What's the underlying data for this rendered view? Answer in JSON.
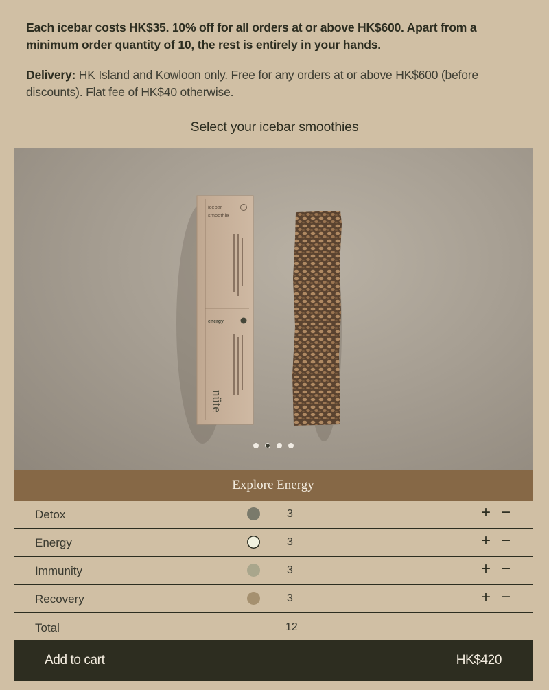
{
  "intro": {
    "pricing_text": "Each icebar costs HK$35. 10% off for all orders at or above HK$600. Apart from a minimum order quantity of 10, the rest is entirely in your hands.",
    "delivery_label": "Delivery:",
    "delivery_text": " HK Island and Kowloon only. Free for any orders at or above HK$600 (before discounts). Flat fee of HK$40 otherwise."
  },
  "section_title": "Select your icebar smoothies",
  "carousel": {
    "box": {
      "brand_line1": "icebar",
      "brand_line2": "smoothie",
      "flavor": "energy",
      "logo": "nüte"
    },
    "slide_count": 4,
    "active_slide": 2
  },
  "explore_label": "Explore Energy",
  "flavors": [
    {
      "name": "Detox",
      "color": "#7a7a6b",
      "qty": "3"
    },
    {
      "name": "Energy",
      "color": "#f1f1df",
      "qty": "3"
    },
    {
      "name": "Immunity",
      "color": "#a9a68c",
      "qty": "3"
    },
    {
      "name": "Recovery",
      "color": "#a5906f",
      "qty": "3"
    }
  ],
  "controls": {
    "plus": "+",
    "minus": "−"
  },
  "total": {
    "label": "Total",
    "qty": "12"
  },
  "cart": {
    "label": "Add to cart",
    "price": "HK$420"
  },
  "colors": {
    "background": "#d0bfa4",
    "explore_bar": "#866846",
    "cart_button": "#2d2d20"
  }
}
